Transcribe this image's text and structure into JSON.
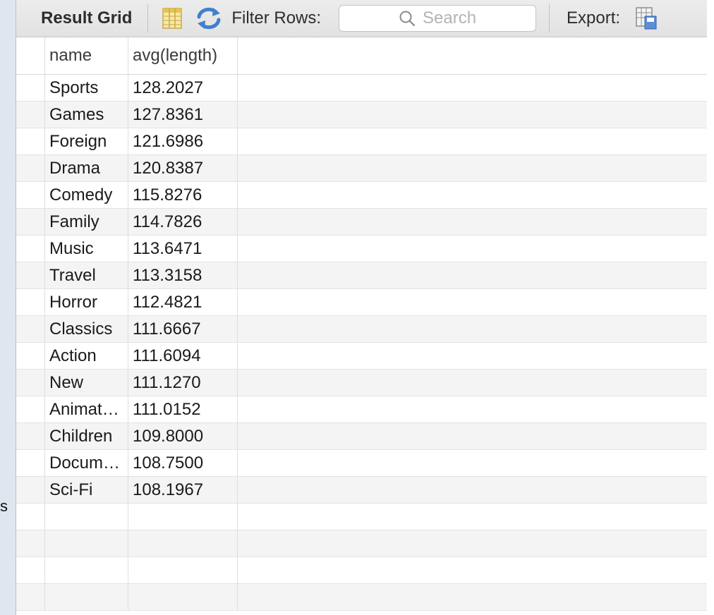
{
  "toolbar": {
    "title": "Result Grid",
    "grid_icon": "form-grid-icon",
    "refresh_icon": "refresh-icon",
    "filter_label": "Filter Rows:",
    "search_placeholder": "Search",
    "export_label": "Export:",
    "export_icon": "export-grid-icon"
  },
  "side_panel": {
    "clipped_text": "s"
  },
  "columns": [
    "name",
    "avg(length)"
  ],
  "rows": [
    {
      "name": "Sports",
      "avg": "128.2027"
    },
    {
      "name": "Games",
      "avg": "127.8361"
    },
    {
      "name": "Foreign",
      "avg": "121.6986"
    },
    {
      "name": "Drama",
      "avg": "120.8387"
    },
    {
      "name": "Comedy",
      "avg": "115.8276"
    },
    {
      "name": "Family",
      "avg": "114.7826"
    },
    {
      "name": "Music",
      "avg": "113.6471"
    },
    {
      "name": "Travel",
      "avg": "113.3158"
    },
    {
      "name": "Horror",
      "avg": "112.4821"
    },
    {
      "name": "Classics",
      "avg": "111.6667"
    },
    {
      "name": "Action",
      "avg": "111.6094"
    },
    {
      "name": "New",
      "avg": "111.1270"
    },
    {
      "name": "Animat…",
      "avg": "111.0152"
    },
    {
      "name": "Children",
      "avg": "109.8000"
    },
    {
      "name": "Docum…",
      "avg": "108.7500"
    },
    {
      "name": "Sci-Fi",
      "avg": "108.1967"
    }
  ],
  "colors": {
    "accent_blue": "#3f7fd0",
    "toolbar_bg": "#e6e6e6",
    "row_alt": "#f4f4f4"
  }
}
